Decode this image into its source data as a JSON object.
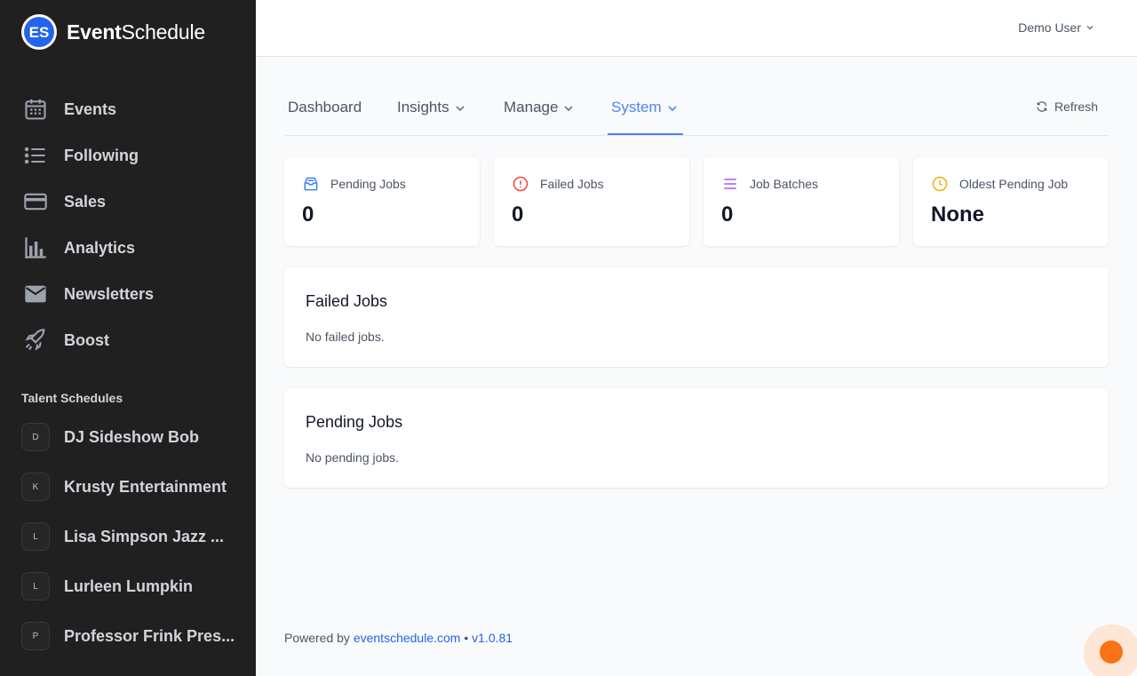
{
  "brand": {
    "name_bold": "Event",
    "name_light": "Schedule",
    "logo_text": "ES"
  },
  "sidebar": {
    "nav": [
      {
        "label": "Events",
        "icon": "calendar-icon"
      },
      {
        "label": "Following",
        "icon": "list-icon"
      },
      {
        "label": "Sales",
        "icon": "credit-card-icon"
      },
      {
        "label": "Analytics",
        "icon": "bar-chart-icon"
      },
      {
        "label": "Newsletters",
        "icon": "mail-icon"
      },
      {
        "label": "Boost",
        "icon": "rocket-icon"
      }
    ],
    "section_title": "Talent Schedules",
    "talents": [
      {
        "initial": "D",
        "label": "DJ Sideshow Bob"
      },
      {
        "initial": "K",
        "label": "Krusty Entertainment"
      },
      {
        "initial": "L",
        "label": "Lisa Simpson Jazz ..."
      },
      {
        "initial": "L",
        "label": "Lurleen Lumpkin"
      },
      {
        "initial": "P",
        "label": "Professor Frink Pres..."
      }
    ]
  },
  "header": {
    "user_name": "Demo User"
  },
  "tabs": [
    {
      "label": "Dashboard",
      "dropdown": false
    },
    {
      "label": "Insights",
      "dropdown": true
    },
    {
      "label": "Manage",
      "dropdown": true
    },
    {
      "label": "System",
      "dropdown": true,
      "active": true
    }
  ],
  "refresh_label": "Refresh",
  "stats": [
    {
      "label": "Pending Jobs",
      "value": "0",
      "icon": "inbox-icon",
      "color": "#3b82f6"
    },
    {
      "label": "Failed Jobs",
      "value": "0",
      "icon": "alert-circle-icon",
      "color": "#ef4444"
    },
    {
      "label": "Job Batches",
      "value": "0",
      "icon": "list-icon",
      "color": "#a855f7"
    },
    {
      "label": "Oldest Pending Job",
      "value": "None",
      "icon": "clock-icon",
      "color": "#eab308"
    }
  ],
  "panels": {
    "failed": {
      "title": "Failed Jobs",
      "body": "No failed jobs."
    },
    "pending": {
      "title": "Pending Jobs",
      "body": "No pending jobs."
    }
  },
  "footer": {
    "prefix": "Powered by",
    "link": "eventschedule.com",
    "separator": "•",
    "version": "v1.0.81"
  },
  "colors": {
    "accent": "#4e81fa",
    "sidebar_bg": "#202020",
    "brand_blue": "#2563eb"
  }
}
